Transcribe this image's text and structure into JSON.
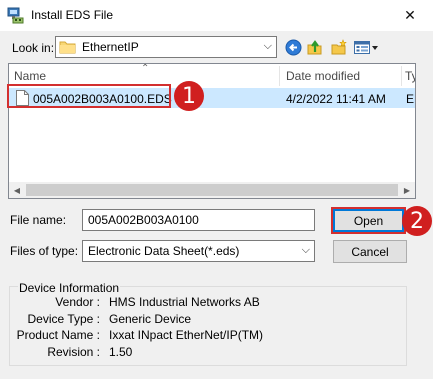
{
  "window": {
    "title": "Install EDS File",
    "close_glyph": "✕"
  },
  "lookin": {
    "label": "Look in:",
    "value": "EthernetIP"
  },
  "toolbar": {
    "back_icon": "back-arrow-icon",
    "up_icon": "up-folder-icon",
    "new_folder_icon": "new-folder-icon",
    "view_icon": "view-menu-icon"
  },
  "filelist": {
    "columns": [
      "Name",
      "Date modified",
      "Ty"
    ],
    "rows": [
      {
        "name": "005A002B003A0100.EDS",
        "date": "4/2/2022 11:41 AM",
        "type": "ED"
      }
    ]
  },
  "callouts": {
    "step1": "1",
    "step2": "2",
    "color": "#d32f2f"
  },
  "form": {
    "filename_label": "File name:",
    "filename_value": "005A002B003A0100",
    "filetype_label": "Files of type:",
    "filetype_value": "Electronic Data Sheet(*.eds)",
    "open_label": "Open",
    "cancel_label": "Cancel"
  },
  "device_info": {
    "title": "Device Information",
    "fields": [
      {
        "key": "Vendor :",
        "value": "HMS Industrial Networks AB"
      },
      {
        "key": "Device Type :",
        "value": "Generic Device"
      },
      {
        "key": "Product Name :",
        "value": "Ixxat INpact EtherNet/IP(TM)"
      },
      {
        "key": "Revision :",
        "value": "1.50"
      }
    ]
  },
  "colors": {
    "selection": "#cce8ff",
    "accent": "#0078d7",
    "dialog_bg": "#f0f0f0"
  }
}
